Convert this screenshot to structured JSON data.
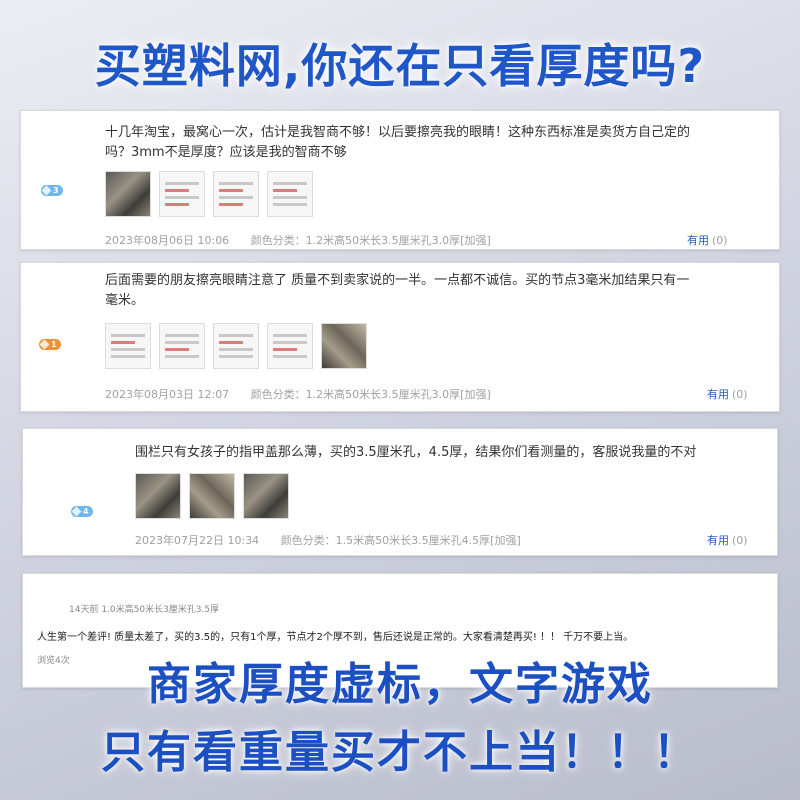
{
  "headline": "买塑料网,你还在只看厚度吗?",
  "reviews": [
    {
      "badge": "3",
      "text_line1": "十几年淘宝，最窝心一次，估计是我智商不够！以后要擦亮我的眼睛！这种东西标准是卖货方自己定的",
      "text_line2": "吗？3mm不是厚度？应该是我的智商不够",
      "date": "2023年08月06日 10:06",
      "variant": "颜色分类：1.2米高50米长3.5厘米孔3.0厚[加强]",
      "helpful_label": "有用",
      "helpful_count": "(0)"
    },
    {
      "badge": "1",
      "text_line1": "后面需要的朋友擦亮眼睛注意了 质量不到卖家说的一半。一点都不诚信。买的节点3毫米加结果只有一",
      "text_line2": "毫米。",
      "date": "2023年08月03日 12:07",
      "variant": "颜色分类：1.2米高50米长3.5厘米孔3.0厚[加强]",
      "helpful_label": "有用",
      "helpful_count": "(0)"
    },
    {
      "badge": "4",
      "text_line1": "围栏只有女孩子的指甲盖那么薄，买的3.5厘米孔，4.5厚，结果你们看测量的，客服说我量的不对",
      "date": "2023年07月22日 10:34",
      "variant": "颜色分类：1.5米高50米长3.5厘米孔4.5厚[加强]",
      "helpful_label": "有用",
      "helpful_count": "(0)"
    },
    {
      "meta": "14天前 1.0米高50米长3厘米孔3.5厚",
      "text": "人生第一个差评! 质量太差了，买的3.5的，只有1个厚，节点才2个厚不到，售后还说是正常的。大家看清楚再买! ！！ 千万不要上当。",
      "views": "浏览4次"
    }
  ],
  "overlay_line1": "商家厚度虚标，文字游戏",
  "overlay_line2": "只有看重量买才不上当！！！",
  "colors": {
    "headline": "#1f56c8",
    "link": "#1f5fb6",
    "badge_blue": "#6fb7ee",
    "badge_orange": "#f19135"
  }
}
